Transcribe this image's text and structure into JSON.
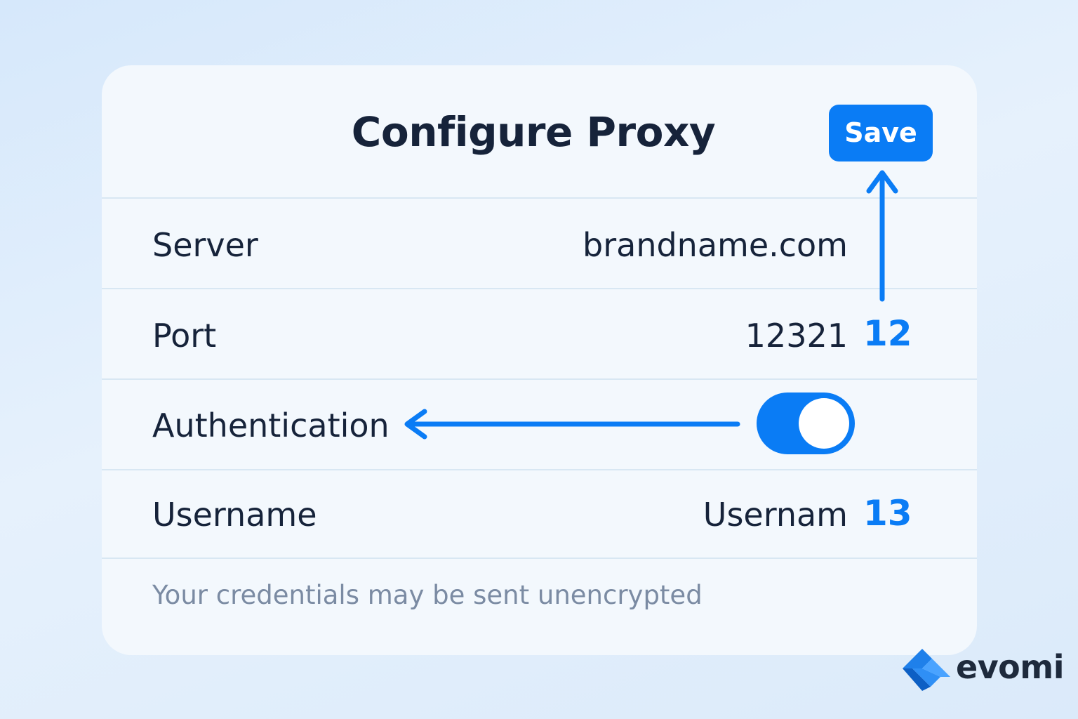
{
  "dialog": {
    "title": "Configure Proxy",
    "save_label": "Save",
    "rows": [
      {
        "label": "Server",
        "value": "brandname.com"
      },
      {
        "label": "Port",
        "value": "12321"
      },
      {
        "label": "Authentication",
        "toggle_on": true
      },
      {
        "label": "Username",
        "value": "Usernam"
      }
    ],
    "footnote": "Your credentials may be sent unencrypted"
  },
  "annotations": {
    "port_marker": "12",
    "username_marker": "13"
  },
  "brand": {
    "name": "evomi"
  },
  "colors": {
    "accent": "#0a7cf5",
    "text": "#16233a",
    "muted": "#7b8ba3",
    "card": "#f3f8fd",
    "background": "#dbeafa"
  },
  "icons": {
    "annotation_arrows": "arrow-up-icon, arrow-left-icon",
    "logo": "evomi-logo-icon"
  }
}
